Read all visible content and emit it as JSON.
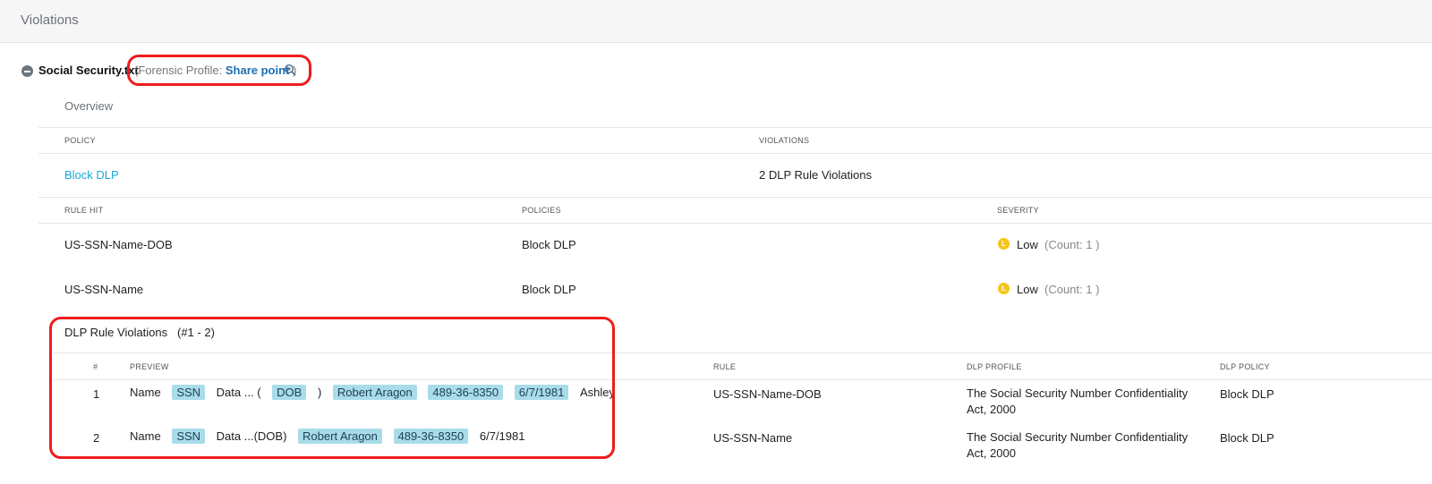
{
  "header": {
    "title": "Violations"
  },
  "file": {
    "name": "Social Security.txt",
    "forensic_prefix": "(Forensic Profile: ",
    "forensic_link": "Share point",
    "forensic_suffix": " )"
  },
  "tabs": {
    "overview": "Overview"
  },
  "policy_table": {
    "headers": {
      "policy": "POLICY",
      "violations": "VIOLATIONS"
    },
    "row": {
      "policy": "Block DLP",
      "violations": "2 DLP Rule Violations"
    }
  },
  "rules_table": {
    "headers": {
      "rule_hit": "RULE HIT",
      "policies": "POLICIES",
      "severity": "SEVERITY"
    },
    "rows": [
      {
        "rule_hit": "US-SSN-Name-DOB",
        "policies": "Block DLP",
        "severity_badge": "L",
        "severity": "Low",
        "count": "(Count: 1 )"
      },
      {
        "rule_hit": "US-SSN-Name",
        "policies": "Block DLP",
        "severity_badge": "L",
        "severity": "Low",
        "count": "(Count: 1 )"
      }
    ]
  },
  "dlp_violations": {
    "title": "DLP Rule Violations",
    "range": "(#1 - 2)",
    "headers": {
      "num": "#",
      "preview": "PREVIEW",
      "rule": "RULE",
      "dlp_profile": "DLP PROFILE",
      "dlp_policy": "DLP POLICY"
    },
    "rows": [
      {
        "num": "1",
        "preview": {
          "t1": "Name",
          "c1": "SSN",
          "t2": "Data ... (",
          "c2": "DOB",
          "t3": ")",
          "c3": "Robert Aragon",
          "c4": "489-36-8350",
          "c5": "6/7/1981",
          "t4": "Ashley"
        },
        "rule": "US-SSN-Name-DOB",
        "dlp_profile": "The Social Security Number Confidentiality Act, 2000",
        "dlp_policy": "Block DLP"
      },
      {
        "num": "2",
        "preview": {
          "t1": "Name",
          "c1": "SSN",
          "t2": "Data ...(DOB)",
          "c2": "Robert Aragon",
          "c3": "489-36-8350",
          "t3": "6/7/1981"
        },
        "rule": "US-SSN-Name",
        "dlp_profile": "The Social Security Number Confidentiality Act, 2000",
        "dlp_policy": "Block DLP"
      }
    ]
  },
  "colors": {
    "highlight_border": "#ee1c1c",
    "link_cyan": "#1aa9d4",
    "link_blue": "#1b6fb3",
    "severity_low": "#f5c518",
    "chip_bg": "#a9dcea"
  }
}
